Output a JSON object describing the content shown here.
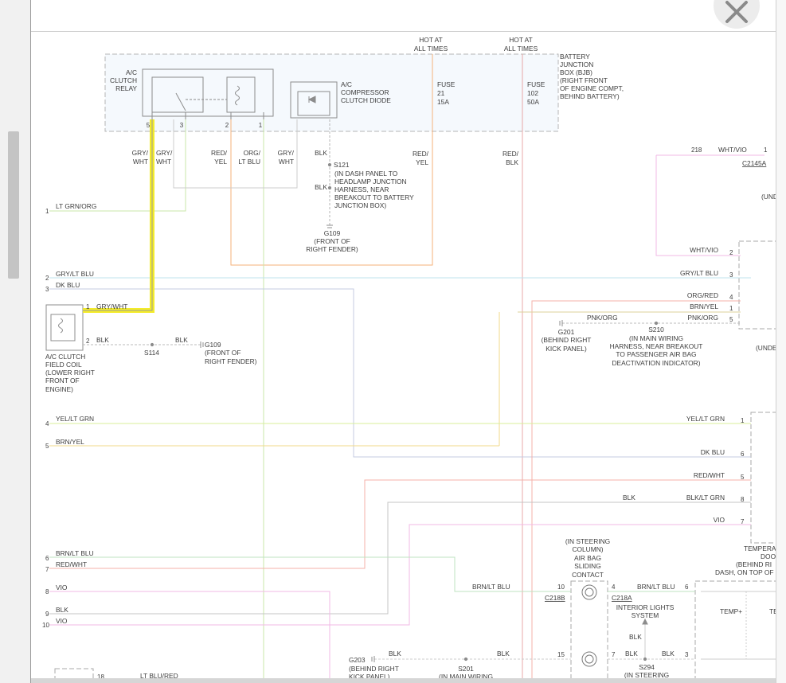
{
  "viewer": {
    "close_icon": "close-icon"
  },
  "relay": {
    "lines": [
      "A/C",
      "CLUTCH",
      "RELAY"
    ],
    "pins": [
      "5",
      "3",
      "2",
      "1"
    ]
  },
  "diode": {
    "lines": [
      "A/C",
      "COMPRESSOR",
      "CLUTCH DIODE"
    ]
  },
  "bjb": {
    "lines": [
      "BATTERY",
      "JUNCTION",
      "BOX (BJB)",
      "(RIGHT FRONT",
      "OF ENGINE COMPT,",
      "BEHIND BATTERY)"
    ]
  },
  "hot1": [
    "HOT AT",
    "ALL TIMES"
  ],
  "hot2": [
    "HOT AT",
    "ALL TIMES"
  ],
  "fuse21": [
    "FUSE",
    "21",
    "15A"
  ],
  "fuse102": [
    "FUSE",
    "102",
    "50A"
  ],
  "relay_wires": {
    "w1": [
      "GRY/",
      "WHT"
    ],
    "w2": [
      "GRY/",
      "WHT"
    ],
    "w3": [
      "RED/",
      "YEL"
    ],
    "w4": [
      "ORG/",
      "LT BLU"
    ],
    "w5": [
      "GRY/",
      "WHT"
    ],
    "w6": "BLK",
    "w7": [
      "RED/",
      "YEL"
    ],
    "w8": [
      "RED/",
      "BLK"
    ]
  },
  "s121": {
    "label": "S121",
    "blk": "BLK",
    "desc": [
      "(IN DASH PANEL TO",
      "HEADLAMP JUNCTION",
      "HARNESS, NEAR",
      "BREAKOUT TO BATTERY",
      "JUNCTION BOX)"
    ]
  },
  "g109a": [
    "G109",
    "(FRONT OF",
    "RIGHT FENDER)"
  ],
  "left_pins": [
    {
      "num": "1",
      "wire": "LT GRN/ORG"
    },
    {
      "num": "2",
      "wire": "GRY/LT BLU"
    },
    {
      "num": "3",
      "wire": "DK BLU"
    },
    {
      "num": "4",
      "wire": "YEL/LT GRN"
    },
    {
      "num": "5",
      "wire": "BRN/YEL"
    },
    {
      "num": "6",
      "wire": "BRN/LT BLU"
    },
    {
      "num": "7",
      "wire": "RED/WHT"
    },
    {
      "num": "8",
      "wire": "VIO"
    },
    {
      "num": "9",
      "wire": "BLK"
    },
    {
      "num": "10",
      "wire": "VIO"
    },
    {
      "num": "18",
      "wire": "LT BLU/RED"
    }
  ],
  "field_coil": {
    "pin1": "1",
    "wire1": "GRY/WHT",
    "pin2": "2",
    "wire2": "BLK",
    "s114": "S114",
    "blk2": "BLK",
    "lines": [
      "A/C CLUTCH",
      "FIELD COIL",
      "(LOWER RIGHT",
      "FRONT OF",
      "ENGINE)"
    ]
  },
  "g109b": [
    "G109",
    "(FRONT OF",
    "RIGHT FENDER)"
  ],
  "right_top": {
    "num218": "218",
    "wire218": "WHT/VIO",
    "pin1": "1",
    "c2145a": "C2145A",
    "und1": "(UND",
    "pins": [
      {
        "num": "2",
        "wire": "WHT/VIO"
      },
      {
        "num": "3",
        "wire": "GRY/LT BLU"
      },
      {
        "num": "4",
        "wire": "ORG/RED"
      },
      {
        "num": "1",
        "wire": "BRN/YEL"
      },
      {
        "num": "5",
        "wire": "PNK/ORG"
      }
    ],
    "und2": "(UNDE"
  },
  "g201": {
    "lines": [
      "G201",
      "(BEHIND RIGHT",
      "KICK PANEL)"
    ],
    "wire": "PNK/ORG"
  },
  "s210": {
    "lines": [
      "S210",
      "(IN MAIN WIRING",
      "HARNESS, NEAR BREAKOUT",
      "TO PASSENGER AIR BAG",
      "DEACTIVATION INDICATOR)"
    ]
  },
  "temp_door": {
    "pins": [
      {
        "num": "1",
        "wire": "YEL/LT GRN"
      },
      {
        "num": "6",
        "wire": "DK BLU"
      },
      {
        "num": "5",
        "wire": "RED/WHT"
      },
      {
        "num": "8",
        "wire": "BLK/LT GRN"
      },
      {
        "num": "7",
        "wire": "VIO"
      }
    ],
    "blk": "BLK",
    "lines": [
      "TEMPERA",
      "DOO",
      "(BEHIND RI",
      "DASH, ON TOP OF"
    ]
  },
  "steering": {
    "lines": [
      "(IN STEERING",
      "COLUMN)",
      "AIR BAG",
      "SLIDING",
      "CONTACT"
    ],
    "pin10": "10",
    "pin4": "4",
    "pin15": "15",
    "pin7": "7",
    "c218b": "C218B",
    "c218a": "C218A",
    "wire_left": "BRN/LT BLU",
    "wire_right": "BRN/LT BLU",
    "pin6": "6",
    "interior": [
      "INTERIOR LIGHTS",
      "SYSTEM"
    ],
    "blk_up": "BLK",
    "blk_s294a": "BLK",
    "blk_s294b": "BLK",
    "pin3": "3",
    "s294": [
      "S294",
      "(IN STEERING"
    ],
    "temp_plus": "TEMP+",
    "te": "TE"
  },
  "g203": {
    "lines": [
      "G203",
      "(BEHIND RIGHT",
      "KICK PANEL)"
    ],
    "blk1": "BLK",
    "blk2": "BLK"
  },
  "s201": [
    "S201",
    "(IN MAIN WIRING"
  ]
}
